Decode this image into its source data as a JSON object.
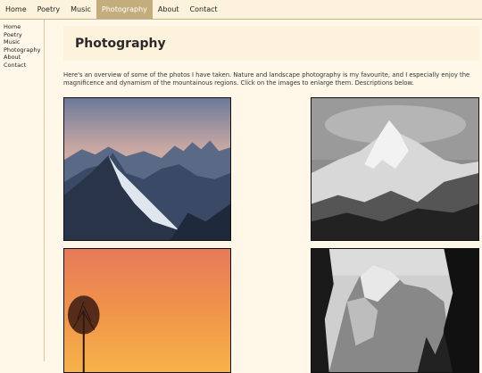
{
  "nav": {
    "items": [
      "Home",
      "Poetry",
      "Music",
      "Photography",
      "About",
      "Contact"
    ],
    "active": "Photography"
  },
  "sidebar": {
    "items": [
      "Home",
      "Poetry",
      "Music",
      "Photography",
      "About",
      "Contact"
    ]
  },
  "page": {
    "title": "Photography",
    "intro": "Here's an overview of some of the photos I have taken. Nature and landscape photography is my favourite, and I especially enjoy the magnificence and dynamism of the mountainous regions. Click on the images to enlarge them. Descriptions below."
  },
  "colors": {
    "background": "#fff8e8",
    "nav_active": "#c4ad7c",
    "header_bg": "#fdf3dc"
  }
}
